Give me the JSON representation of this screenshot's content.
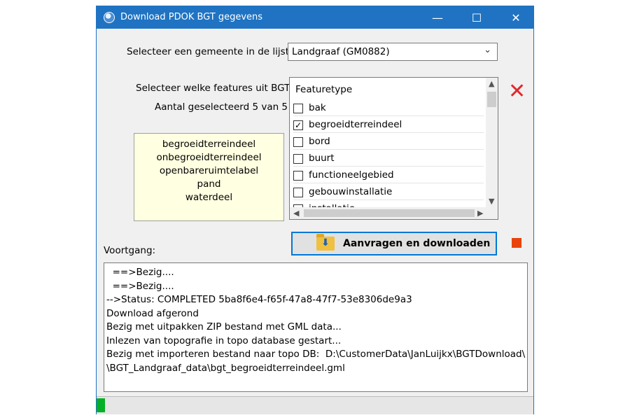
{
  "window": {
    "title": "Download PDOK BGT gegevens",
    "controls": {
      "minimize": "—",
      "maximize": "☐",
      "close": "✕"
    }
  },
  "municipality": {
    "label": "Selecteer een gemeente in de lijst",
    "selected": "Landgraaf (GM0882)"
  },
  "features": {
    "label": "Selecteer welke features uit BGT",
    "count_label": "Aantal geselecteerd 5 van 5",
    "header": "Featuretype",
    "items": [
      {
        "name": "bak",
        "checked": false
      },
      {
        "name": "begroeidterreindeel",
        "checked": true
      },
      {
        "name": "bord",
        "checked": false
      },
      {
        "name": "buurt",
        "checked": false
      },
      {
        "name": "functioneelgebied",
        "checked": false
      },
      {
        "name": "gebouwinstallatie",
        "checked": false
      },
      {
        "name": "installatie",
        "checked": false
      }
    ]
  },
  "selected_features": [
    "begroeidterreindeel",
    "onbegroeidterreindeel",
    "openbareruimtelabel",
    "pand",
    "waterdeel"
  ],
  "download_button": {
    "label": "Aanvragen en downloaden"
  },
  "progress": {
    "label": "Voortgang:",
    "fraction": 0.02
  },
  "log": [
    "  ==>Bezig....",
    "  ==>Bezig....",
    "-->Status: COMPLETED 5ba8f6e4-f65f-47a8-47f7-53e8306de9a3",
    "Download afgerond",
    "Bezig met uitpakken ZIP bestand met GML data...",
    "Inlezen van topografie in topo database gestart...",
    "Bezig met importeren bestand naar topo DB:  D:\\CustomerData\\JanLuijkx\\BGTDownload\\",
    "\\BGT_Landgraaf_data\\bgt_begroeidterreindeel.gml"
  ],
  "colors": {
    "titlebar": "#1f73c2",
    "accent_red": "#e0282c",
    "stop": "#e8440c",
    "progress": "#06b025"
  }
}
